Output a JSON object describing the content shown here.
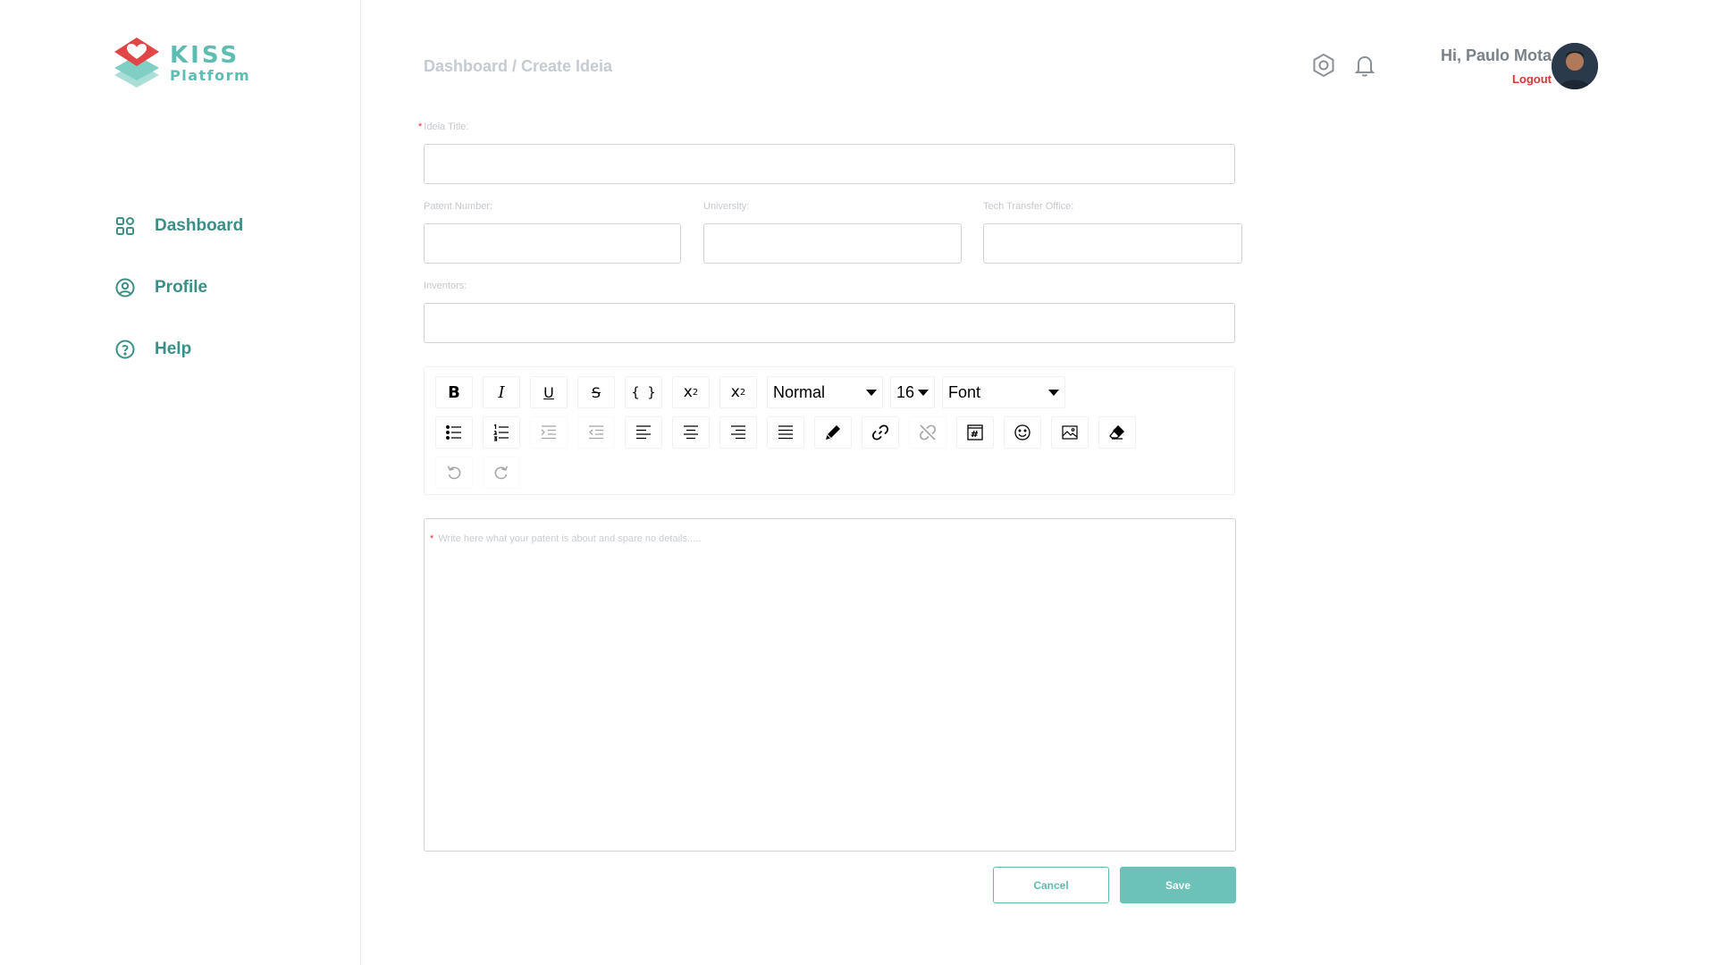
{
  "brand": {
    "name": "KISS",
    "subtitle": "Platform",
    "colors": {
      "teal": "#5dbdb2",
      "red": "#e04646",
      "dark_teal": "#3b8f86"
    }
  },
  "sidebar": {
    "items": [
      {
        "label": "Dashboard",
        "icon": "grid-icon"
      },
      {
        "label": "Profile",
        "icon": "user-circle-icon"
      },
      {
        "label": "Help",
        "icon": "question-circle-icon"
      }
    ]
  },
  "header": {
    "breadcrumb": "Dashboard / Create Ideia",
    "icons": [
      "settings-hex-icon",
      "bell-icon"
    ],
    "user": {
      "greeting": "Hi, Paulo Mota",
      "logout": "Logout"
    }
  },
  "form": {
    "title": {
      "label": "Ideia Title:",
      "value": ""
    },
    "patent_number": {
      "label": "Patent Number:",
      "value": ""
    },
    "university": {
      "label": "University:",
      "value": ""
    },
    "tech_transfer_office": {
      "label": "Tech Transfer Office:",
      "value": ""
    },
    "inventors": {
      "label": "Inventors:",
      "value": ""
    },
    "editor": {
      "placeholder": "Write here what your patent is about and spare no details.....",
      "block_type": "Normal",
      "font_size": "16",
      "font_family": "Font"
    }
  },
  "actions": {
    "cancel": "Cancel",
    "save": "Save"
  }
}
